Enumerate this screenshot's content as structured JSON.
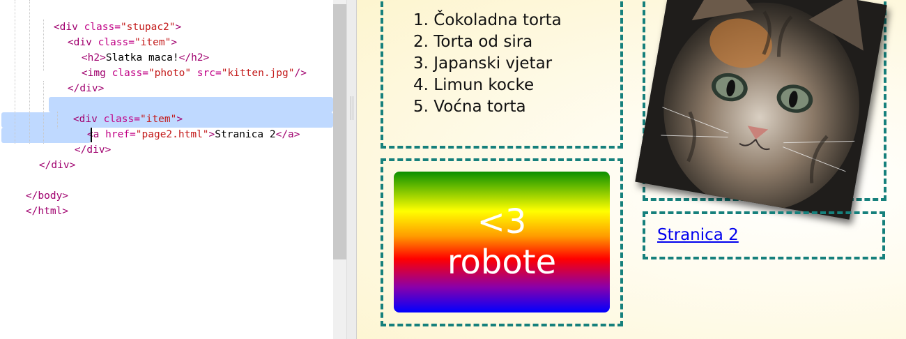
{
  "editor": {
    "lines": [
      [
        "<div class=\"stupac2\">"
      ],
      [
        "<div class=\"item\">"
      ],
      [
        "<h2>Slatka maca!</h2>"
      ],
      [
        "<img class=\"photo\" src=\"kitten.jpg\"/>"
      ],
      [
        "</div>"
      ],
      [
        ""
      ],
      [
        "<div class=\"item\">"
      ],
      [
        "<a href=\"page2.html\">Stranica 2</a>"
      ],
      [
        "</div>"
      ],
      [
        "</div>"
      ],
      [
        ""
      ],
      [
        "</body>"
      ],
      [
        "</html>"
      ]
    ]
  },
  "tokens": {
    "l1_open": "<div",
    "l1_attr": " class=",
    "l1_val": "\"stupac2\"",
    "l1_close": ">",
    "l2_open": "<div",
    "l2_attr": " class=",
    "l2_val": "\"item\"",
    "l2_close": ">",
    "l3_open": "<h2>",
    "l3_text": "Slatka maca!",
    "l3_close": "</h2>",
    "l4_open": "<img",
    "l4_attr1": " class=",
    "l4_val1": "\"photo\"",
    "l4_attr2": " src=",
    "l4_val2": "\"kitten.jpg\"",
    "l4_close": "/>",
    "l5_close": "</div>",
    "l7_open": "<div",
    "l7_attr": " class=",
    "l7_val": "\"item\"",
    "l7_close": ">",
    "l8_open": "<a",
    "l8_attr": " href=",
    "l8_val": "\"page2.html\"",
    "l8_gt": ">",
    "l8_text": "Stranica 2",
    "l8_close": "</a>",
    "l9_close": "</div>",
    "l10_close": "</div>",
    "l12_close": "</body>",
    "l13_close": "</html>"
  },
  "preview": {
    "list_items": [
      "1. Čokoladna torta",
      "2. Torta od sira",
      "3. Japanski vjetar",
      "4. Limun kocke",
      "5. Voćna torta"
    ],
    "rainbow_line1": "<3",
    "rainbow_line2": "robote",
    "link_text": "Stranica 2"
  },
  "colors": {
    "tag": "#a0006e",
    "attr": "#c00085",
    "string": "#c31a1a",
    "selection": "#bfd9ff",
    "dashed_border": "#16807c",
    "link": "#0000ee"
  },
  "icons": [
    "kitten-photo"
  ]
}
